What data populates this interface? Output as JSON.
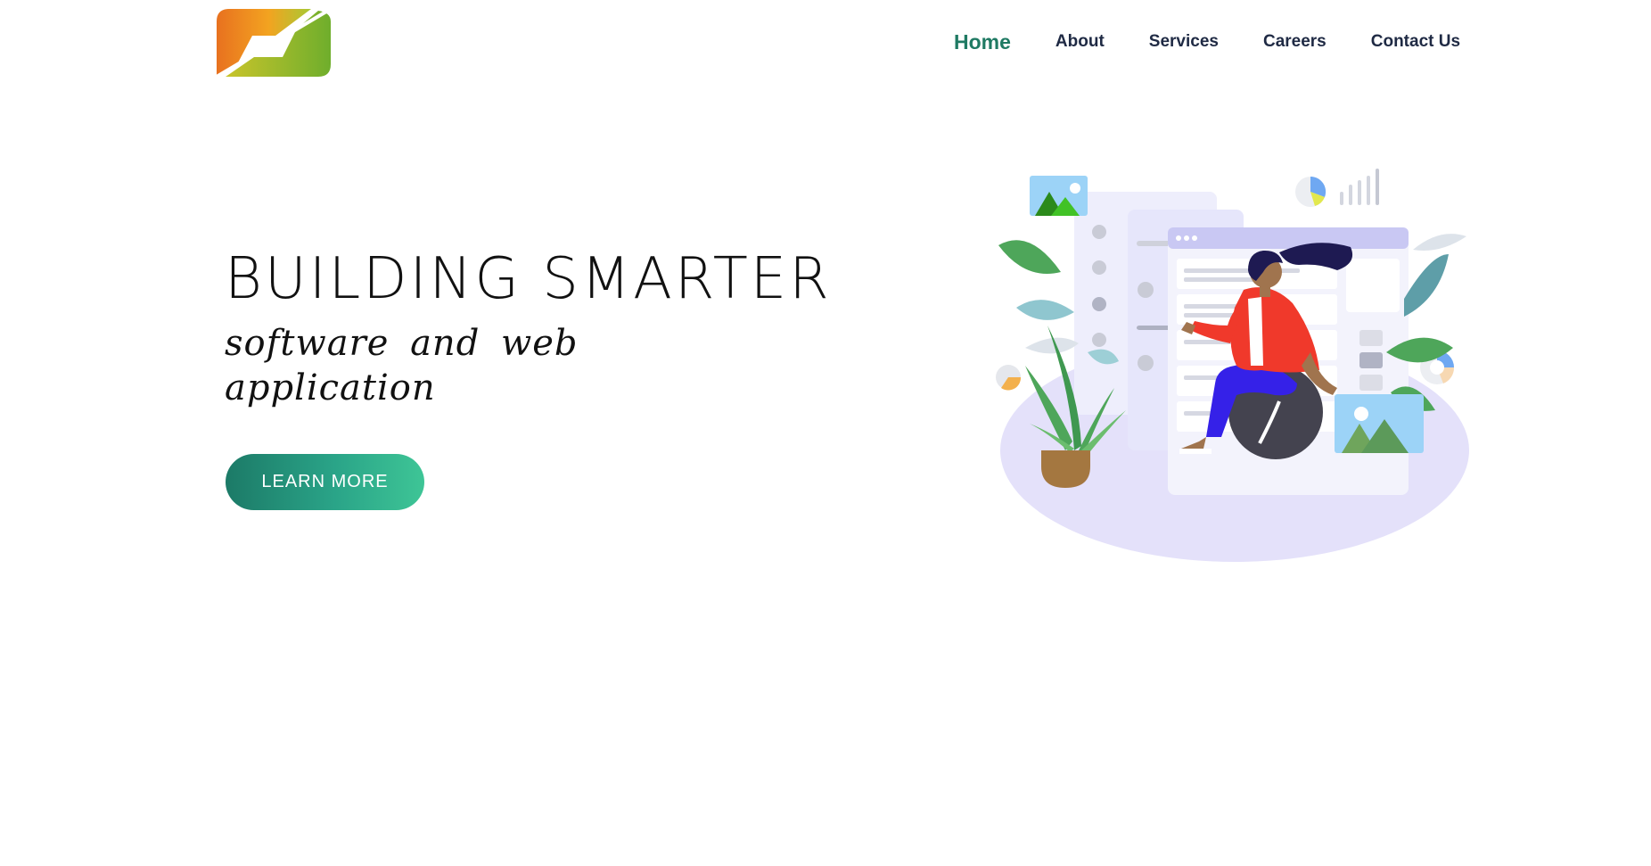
{
  "header": {
    "nav": [
      {
        "label": "Home",
        "active": true
      },
      {
        "label": "About",
        "active": false
      },
      {
        "label": "Services",
        "active": false
      },
      {
        "label": "Careers",
        "active": false
      },
      {
        "label": "Contact Us",
        "active": false
      }
    ]
  },
  "hero": {
    "title": "BUILDING SMARTER",
    "subtitle": "software and web application",
    "cta_label": "LEARN MORE"
  },
  "colors": {
    "accent": "#1f7a63",
    "nav_text": "#1f2a44",
    "cta_gradient_start": "#1c7a67",
    "cta_gradient_end": "#3ec596",
    "logo_orange": "#e8711f",
    "logo_green": "#7db52f",
    "illustration_jacket": "#f0392b",
    "illustration_pants": "#3521e8",
    "illustration_floor": "#e4e1fa"
  },
  "icons": {
    "logo": "brand-logo",
    "illustration": "person-on-ball-dashboard-illustration"
  }
}
